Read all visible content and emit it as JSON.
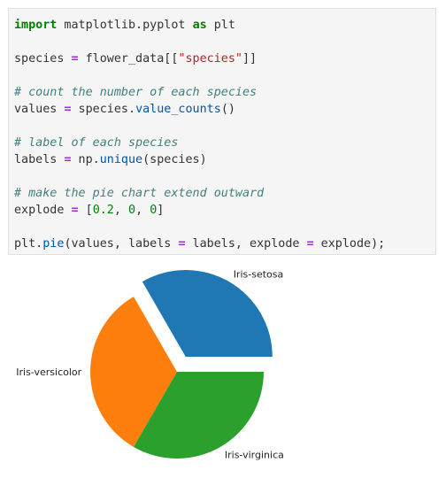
{
  "cell": {
    "lines": [
      [
        {
          "t": "import",
          "c": "kw"
        },
        {
          "t": " matplotlib.pyplot ",
          "c": ""
        },
        {
          "t": "as",
          "c": "kw"
        },
        {
          "t": " plt",
          "c": ""
        }
      ],
      [],
      [
        {
          "t": "species ",
          "c": ""
        },
        {
          "t": "=",
          "c": "op"
        },
        {
          "t": " flower_data[[",
          "c": ""
        },
        {
          "t": "\"species\"",
          "c": "str"
        },
        {
          "t": "]]",
          "c": ""
        }
      ],
      [],
      [
        {
          "t": "# count the number of each species",
          "c": "cm"
        }
      ],
      [
        {
          "t": "values ",
          "c": ""
        },
        {
          "t": "=",
          "c": "op"
        },
        {
          "t": " species.",
          "c": ""
        },
        {
          "t": "value_counts",
          "c": "fn"
        },
        {
          "t": "()",
          "c": ""
        }
      ],
      [],
      [
        {
          "t": "# label of each species",
          "c": "cm"
        }
      ],
      [
        {
          "t": "labels ",
          "c": ""
        },
        {
          "t": "=",
          "c": "op"
        },
        {
          "t": " np.",
          "c": ""
        },
        {
          "t": "unique",
          "c": "fn"
        },
        {
          "t": "(species)",
          "c": ""
        }
      ],
      [],
      [
        {
          "t": "# make the pie chart extend outward",
          "c": "cm"
        }
      ],
      [
        {
          "t": "explode ",
          "c": ""
        },
        {
          "t": "=",
          "c": "op"
        },
        {
          "t": " [",
          "c": ""
        },
        {
          "t": "0.2",
          "c": "num"
        },
        {
          "t": ", ",
          "c": ""
        },
        {
          "t": "0",
          "c": "num"
        },
        {
          "t": ", ",
          "c": ""
        },
        {
          "t": "0",
          "c": "num"
        },
        {
          "t": "]",
          "c": ""
        }
      ],
      [],
      [
        {
          "t": "plt.",
          "c": ""
        },
        {
          "t": "pie",
          "c": "fn"
        },
        {
          "t": "(values, labels ",
          "c": ""
        },
        {
          "t": "=",
          "c": "op"
        },
        {
          "t": " labels, explode ",
          "c": ""
        },
        {
          "t": "=",
          "c": "op"
        },
        {
          "t": " explode);",
          "c": ""
        }
      ]
    ]
  },
  "chart_data": {
    "type": "pie",
    "categories": [
      "Iris-setosa",
      "Iris-versicolor",
      "Iris-virginica"
    ],
    "values": [
      50,
      50,
      50
    ],
    "explode": [
      0.2,
      0,
      0
    ],
    "colors": [
      "#1f77b4",
      "#ff7f0e",
      "#2ca02c"
    ],
    "start_angle_deg": 0,
    "direction": "counterclockwise"
  }
}
